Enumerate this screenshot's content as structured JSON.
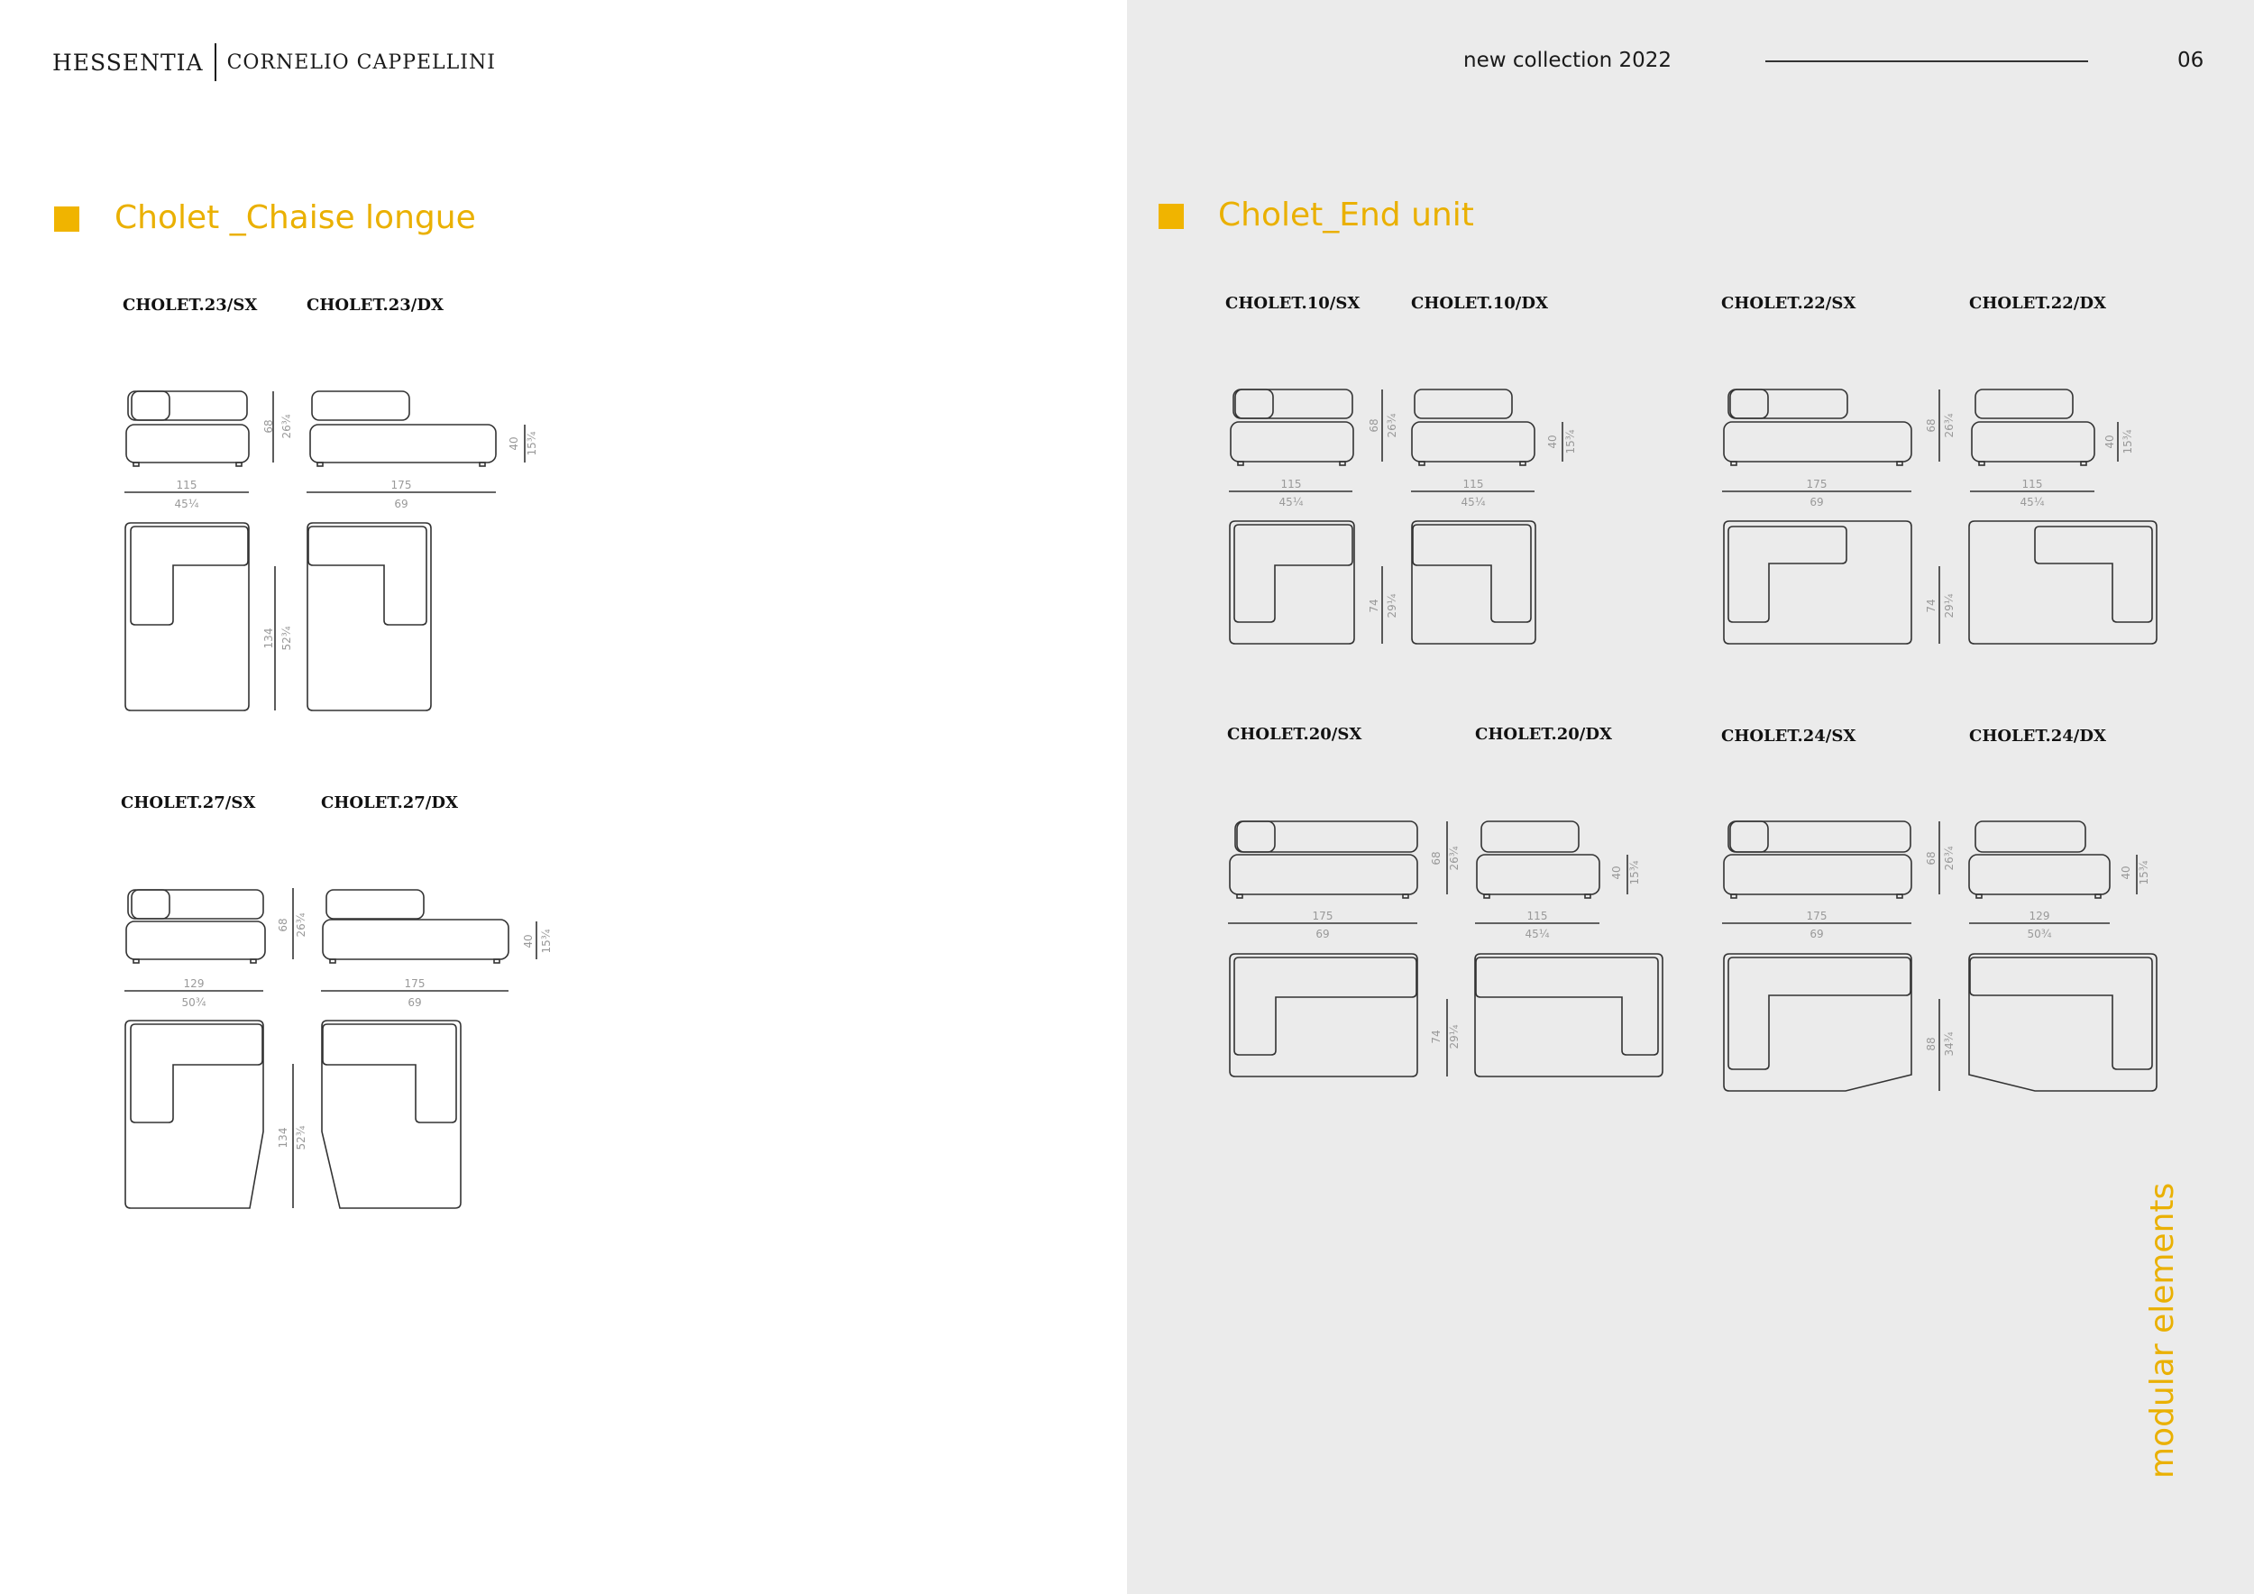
{
  "header": {
    "brand": "HESSENTIA",
    "sub_brand": "CORNELIO CAPPELLINI",
    "title": "new collection 2022",
    "page_number": "06"
  },
  "sections": {
    "chaise_longue": {
      "title": "Cholet _Chaise longue",
      "codes": [
        "CHOLET.23/SX",
        "CHOLET.23/DX",
        "CHOLET.27/SX",
        "CHOLET.27/DX"
      ]
    },
    "end_unit": {
      "title": "Cholet_End unit",
      "codes": [
        "CHOLET.10/SX",
        "CHOLET.10/DX",
        "CHOLET.22/SX",
        "CHOLET.22/DX",
        "CHOLET.20/SX",
        "CHOLET.20/DX",
        "CHOLET.24/SX",
        "CHOLET.24/DX"
      ]
    }
  },
  "dimensions": {
    "cm_115": "115",
    "in_115": "45¼",
    "cm_175": "175",
    "in_175": "69",
    "cm_129": "129",
    "in_129": "50¾",
    "cm_68": "68",
    "in_68": "26¾",
    "cm_40": "40",
    "in_40": "15¾",
    "cm_134": "134",
    "in_134": "52¾",
    "cm_74": "74",
    "in_74": "29¼",
    "cm_88": "88",
    "in_88": "34¾"
  },
  "side_label": "modular elements",
  "colors": {
    "accent": "#f0b400",
    "right_panel_bg": "#ebebeb"
  }
}
